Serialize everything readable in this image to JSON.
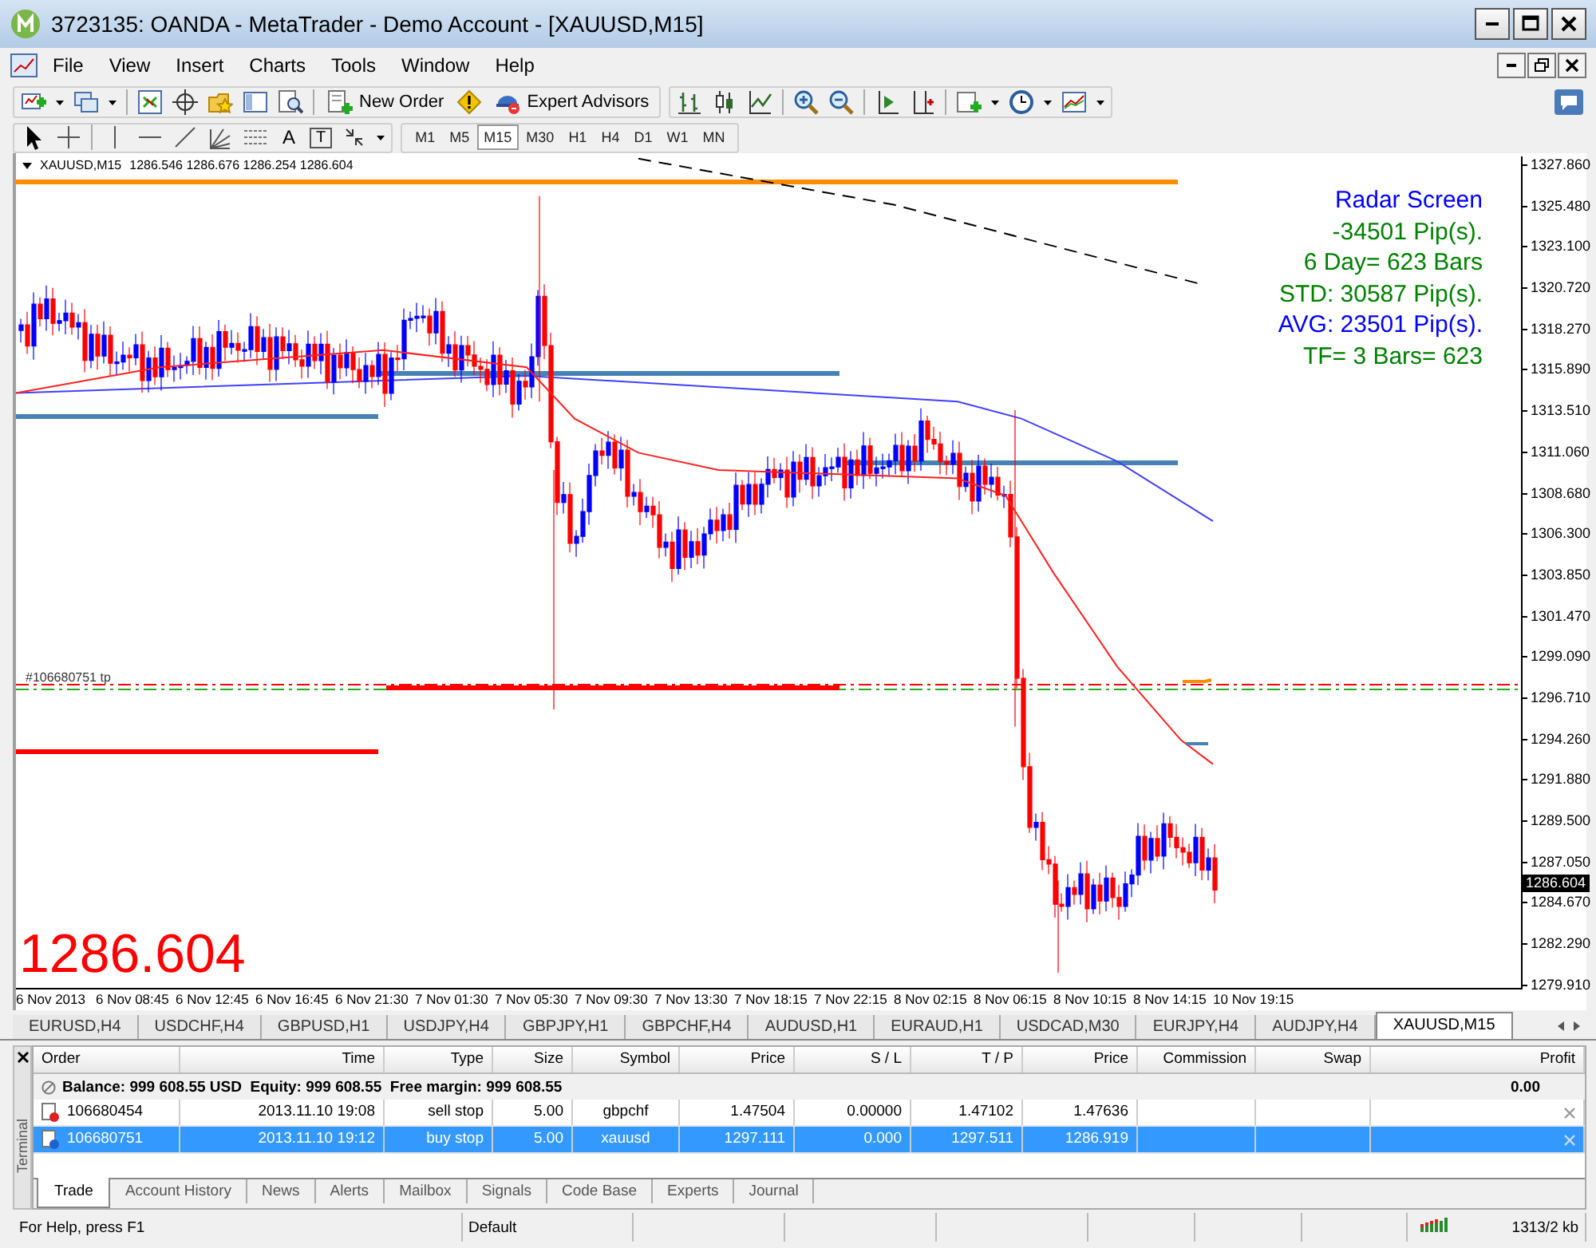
{
  "window": {
    "title": "3723135: OANDA - MetaTrader - Demo Account - [XAUUSD,M15]"
  },
  "menu": [
    "File",
    "View",
    "Insert",
    "Charts",
    "Tools",
    "Window",
    "Help"
  ],
  "toolbar": {
    "new_order": "New Order",
    "expert_advisors": "Expert Advisors"
  },
  "text_tools": [
    {
      "label": "A",
      "kind": "text"
    },
    {
      "label": "T",
      "kind": "label"
    }
  ],
  "timeframes": [
    {
      "label": "M1",
      "selected": false
    },
    {
      "label": "M5",
      "selected": false
    },
    {
      "label": "M15",
      "selected": true
    },
    {
      "label": "M30",
      "selected": false
    },
    {
      "label": "H1",
      "selected": false
    },
    {
      "label": "H4",
      "selected": false
    },
    {
      "label": "D1",
      "selected": false
    },
    {
      "label": "W1",
      "selected": false
    },
    {
      "label": "MN",
      "selected": false
    }
  ],
  "chart": {
    "symbol": "XAUUSD,M15",
    "quotes": "1286.546 1286.676 1286.254 1286.604",
    "radar": [
      {
        "text": "Radar Screen",
        "color": "#0000ff"
      },
      {
        "text": "-34501 Pip(s).",
        "color": "#008000"
      },
      {
        "text": "6 Day= 623 Bars",
        "color": "#008000"
      },
      {
        "text": "STD: 30587 Pip(s).",
        "color": "#008000"
      },
      {
        "text": "AVG: 23501 Pip(s).",
        "color": "#0000ff"
      },
      {
        "text": "TF= 3 Bars= 623",
        "color": "#008000"
      }
    ],
    "order_label": "#106680751 tp",
    "last_price": "1286.604",
    "price_marker": "1286.604",
    "price_axis": [
      "1327.860",
      "1325.480",
      "1323.100",
      "1320.720",
      "1318.270",
      "1315.890",
      "1313.510",
      "1311.060",
      "1308.680",
      "1306.300",
      "1303.850",
      "1301.470",
      "1299.090",
      "1296.710",
      "1294.260",
      "1291.880",
      "1289.500",
      "1287.050",
      "1284.670",
      "1282.290",
      "1279.910"
    ],
    "time_axis": [
      "6 Nov 2013",
      "6 Nov 08:45",
      "6 Nov 12:45",
      "6 Nov 16:45",
      "6 Nov 21:30",
      "7 Nov 01:30",
      "7 Nov 05:30",
      "7 Nov 09:30",
      "7 Nov 13:30",
      "7 Nov 18:15",
      "7 Nov 22:15",
      "8 Nov 02:15",
      "8 Nov 06:15",
      "8 Nov 10:15",
      "8 Nov 14:15",
      "10 Nov 19:15"
    ]
  },
  "symbol_tabs": [
    {
      "label": "EURUSD,H4",
      "selected": false
    },
    {
      "label": "USDCHF,H4",
      "selected": false
    },
    {
      "label": "GBPUSD,H1",
      "selected": false
    },
    {
      "label": "USDJPY,H4",
      "selected": false
    },
    {
      "label": "GBPJPY,H1",
      "selected": false
    },
    {
      "label": "GBPCHF,H4",
      "selected": false
    },
    {
      "label": "AUDUSD,H1",
      "selected": false
    },
    {
      "label": "EURAUD,H1",
      "selected": false
    },
    {
      "label": "USDCAD,M30",
      "selected": false
    },
    {
      "label": "EURJPY,H4",
      "selected": false
    },
    {
      "label": "AUDJPY,H4",
      "selected": false
    },
    {
      "label": "XAUUSD,M15",
      "selected": true
    }
  ],
  "terminal": {
    "title": "Terminal",
    "columns": [
      "Order",
      "Time",
      "Type",
      "Size",
      "Symbol",
      "Price",
      "S / L",
      "T / P",
      "Price",
      "Commission",
      "Swap",
      "Profit"
    ],
    "balance": {
      "text": "Balance: 999 608.55 USD  Equity: 999 608.55  Free margin: 999 608.55",
      "profit": "0.00"
    },
    "rows": [
      {
        "kind": "sell",
        "order": "106680454",
        "time": "2013.11.10 19:08",
        "type": "sell stop",
        "size": "5.00",
        "symbol": "gbpchf",
        "price": "1.47504",
        "sl": "0.00000",
        "tp": "1.47102",
        "current": "1.47636",
        "selected": false
      },
      {
        "kind": "buy",
        "order": "106680751",
        "time": "2013.11.10 19:12",
        "type": "buy stop",
        "size": "5.00",
        "symbol": "xauusd",
        "price": "1297.111",
        "sl": "0.000",
        "tp": "1297.511",
        "current": "1286.919",
        "selected": true
      }
    ],
    "tabs": [
      {
        "label": "Trade",
        "selected": true
      },
      {
        "label": "Account History",
        "selected": false
      },
      {
        "label": "News",
        "selected": false
      },
      {
        "label": "Alerts",
        "selected": false
      },
      {
        "label": "Mailbox",
        "selected": false
      },
      {
        "label": "Signals",
        "selected": false
      },
      {
        "label": "Code Base",
        "selected": false
      },
      {
        "label": "Experts",
        "selected": false
      },
      {
        "label": "Journal",
        "selected": false
      }
    ]
  },
  "status_bar": {
    "help": "For Help, press F1",
    "profile": "Default",
    "traffic": "1313/2 kb"
  }
}
